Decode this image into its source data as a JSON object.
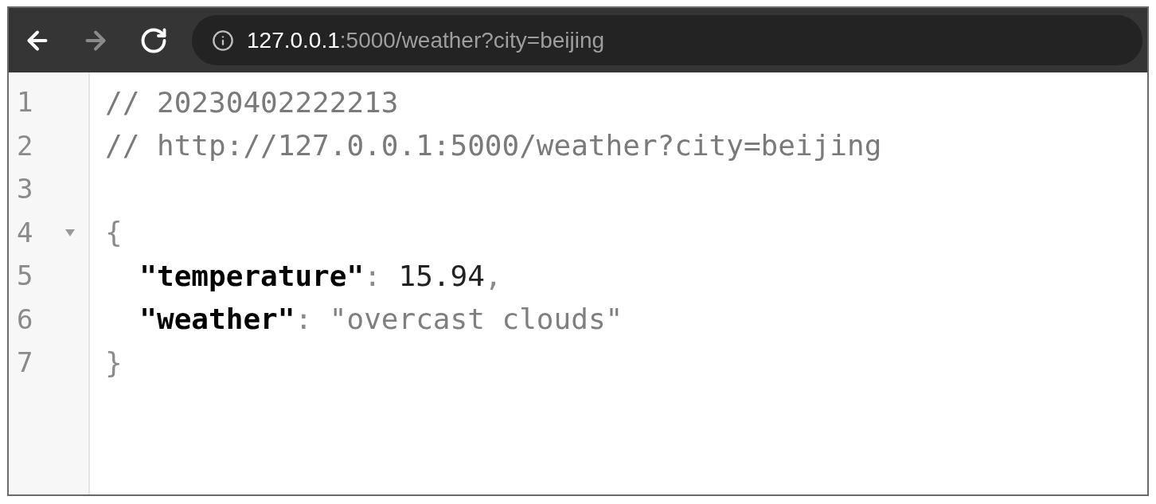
{
  "toolbar": {
    "buttons": [
      {
        "kind": "back",
        "disabled": false
      },
      {
        "kind": "forward",
        "disabled": true
      },
      {
        "kind": "reload",
        "disabled": false
      }
    ]
  },
  "address_bar": {
    "host": "127.0.0.1",
    "path": ":5000/weather?city=beijing"
  },
  "editor": {
    "lines": [
      {
        "number": "1",
        "tokens": [
          {
            "kind": "comment",
            "text": "// 20230402222213"
          }
        ]
      },
      {
        "number": "2",
        "tokens": [
          {
            "kind": "comment",
            "text": "// http://127.0.0.1:5000/weather?city=beijing"
          }
        ]
      },
      {
        "number": "3"
      },
      {
        "number": "4",
        "expanded": true,
        "tokens": [
          {
            "kind": "punct",
            "text": "{"
          }
        ],
        "children": [
          {
            "number": "5",
            "tokens": [
              {
                "kind": "key",
                "text": "\"temperature\""
              },
              {
                "kind": "punct",
                "text": ": "
              },
              {
                "kind": "number",
                "text": "15.94"
              },
              {
                "kind": "punct",
                "text": ","
              }
            ]
          },
          {
            "number": "6",
            "tokens": [
              {
                "kind": "key",
                "text": "\"weather\""
              },
              {
                "kind": "punct",
                "text": ": "
              },
              {
                "kind": "string",
                "text": "\"overcast clouds\""
              }
            ]
          }
        ]
      },
      {
        "number": "7",
        "tokens": [
          {
            "kind": "punct",
            "text": "}"
          }
        ]
      }
    ]
  }
}
